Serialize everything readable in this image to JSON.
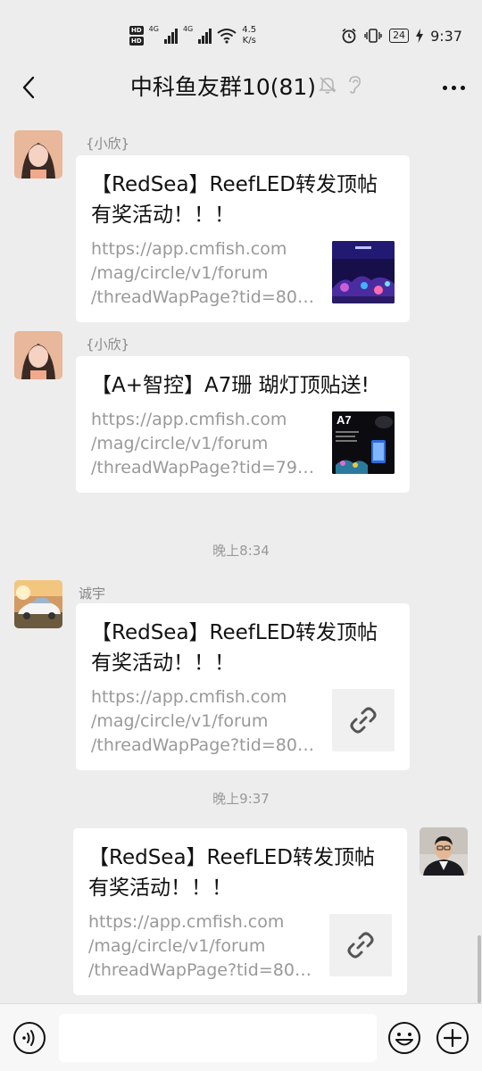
{
  "status_bar": {
    "hd1": "HD",
    "hd2": "HD",
    "net1": "4G",
    "net2": "4G",
    "speed_value": "4.5",
    "speed_unit": "K/s",
    "battery": "24",
    "time": "9:37"
  },
  "nav": {
    "title": "中科鱼友群10(81)",
    "back_icon": "chevron-left-icon",
    "mute_icon": "bell-off-icon",
    "ear_icon": "ear-icon",
    "more_icon": "more-icon"
  },
  "messages": [
    {
      "sender": "{小欣}",
      "title": "【RedSea】ReefLED转发顶帖有奖活动！！！",
      "url_lines": [
        "https://app.cmfish.com",
        "/mag/circle/v1/forum",
        "/threadWapPage?tid=800..."
      ]
    },
    {
      "sender": "{小欣}",
      "title": "【A+智控】A7珊 瑚灯顶贴送!",
      "url_lines": [
        "https://app.cmfish.com",
        "/mag/circle/v1/forum",
        "/threadWapPage?tid=799..."
      ],
      "thumb_text": "A7"
    },
    {
      "sender": "诚宇",
      "title": "【RedSea】ReefLED转发顶帖有奖活动！！！",
      "url_lines": [
        "https://app.cmfish.com",
        "/mag/circle/v1/forum",
        "/threadWapPage?tid=800..."
      ]
    },
    {
      "sender": "",
      "title": "【RedSea】ReefLED转发顶帖有奖活动！！！",
      "url_lines": [
        "https://app.cmfish.com",
        "/mag/circle/v1/forum",
        "/threadWapPage?tid=800..."
      ]
    }
  ],
  "timestamps": [
    "晚上8:34",
    "晚上9:37"
  ],
  "input_bar": {
    "voice_icon": "voice-icon",
    "emoji_icon": "emoji-icon",
    "plus_icon": "plus-icon"
  },
  "colors": {
    "background": "#ededed",
    "bubble": "#ffffff",
    "meta_text": "#999999"
  }
}
